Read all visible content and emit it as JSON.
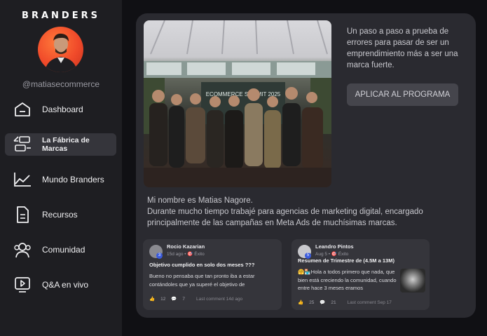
{
  "brand": {
    "logo_text": "BRANDERS",
    "handle": "@matiasecommerce"
  },
  "nav": {
    "items": [
      {
        "label": "Dashboard",
        "icon": "home-icon",
        "active": false
      },
      {
        "label": "La Fábrica de Marcas",
        "icon": "factory-icon",
        "active": true
      },
      {
        "label": "Mundo Branders",
        "icon": "chart-line-icon",
        "active": false
      },
      {
        "label": "Recursos",
        "icon": "document-icon",
        "active": false
      },
      {
        "label": "Comunidad",
        "icon": "users-icon",
        "active": false
      },
      {
        "label": "Q&A en vivo",
        "icon": "play-icon",
        "active": false
      }
    ]
  },
  "promo": {
    "text": "Un paso a paso a prueba de errores para pasar de ser un emprendimiento más a ser una marca fuerte.",
    "button_label": "APLICAR AL PROGRAMA",
    "photo_banner": "ECOMMERCE SUMMIT 2025"
  },
  "bio": {
    "line1": "Mi nombre es Matias Nagore.",
    "line2": "Durante mucho tiempo trabajé para agencias de marketing digital, encargado principalmente de las campañas en Meta Ads de muchísimas marcas."
  },
  "posts": [
    {
      "author": "Rocio Kazarian",
      "level": "3",
      "meta": "15d ago • 🎯 Éxito",
      "title": "Objetivo cumplido en solo dos meses ???",
      "body": "Bueno no pensaba que tan pronto iba a estar contándoles que ya superé el objetivo de",
      "likes": "12",
      "comments": "7",
      "last_comment": "Last comment 14d ago"
    },
    {
      "author": "Leandro Pintos",
      "level": "5",
      "meta": "Aug 5 • 🎯 Éxito",
      "title": "Resumen de Trimestre de (4.5M a 13M)",
      "body": "🤗🏪Hola a todos primero que nada, que bien está creciendo la comunidad, cuando entre hace 3 meses eramos",
      "likes": "25",
      "comments": "21",
      "last_comment": "Last comment Sep 17"
    }
  ],
  "colors": {
    "sidebar_bg": "#1e1e22",
    "card_bg": "#2a2a30",
    "active_bg": "#35353b",
    "avatar_bg": "#f04a2a",
    "level_badge": "#3b5bdb"
  }
}
